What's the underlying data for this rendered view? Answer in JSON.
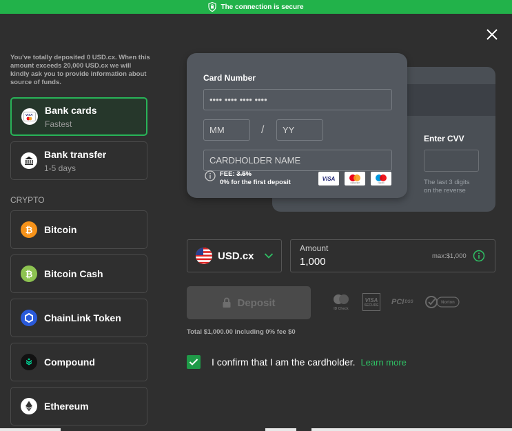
{
  "topbar": {
    "text": "The connection is secure"
  },
  "notice": "You've totally deposited 0 USD.cx. When this amount exceeds 20,000 USD.cx we will kindly ask you to provide information about source of funds.",
  "methods": [
    {
      "title": "Bank cards",
      "sub": "Fastest"
    },
    {
      "title": "Bank transfer",
      "sub": "1-5 days"
    }
  ],
  "crypto_label": "CRYPTO",
  "crypto": [
    {
      "title": "Bitcoin",
      "color": "#f7931a"
    },
    {
      "title": "Bitcoin Cash",
      "color": "#8dc351"
    },
    {
      "title": "ChainLink Token",
      "color": "#2a5ada"
    },
    {
      "title": "Compound",
      "color": "#1a1a1a"
    },
    {
      "title": "Ethereum",
      "color": "#ffffff"
    }
  ],
  "card": {
    "number_label": "Card Number",
    "number_placeholder": "•••• •••• •••• ••••",
    "mm": "MM",
    "slash": "/",
    "yy": "YY",
    "holder": "CARDHOLDER NAME",
    "fee_label": "FEE:",
    "fee_value": "3.5%",
    "fee_note": "0% for the first deposit",
    "cvv_label": "Enter CVV",
    "cvv_hint_1": "The last 3 digits",
    "cvv_hint_2": "on the reverse",
    "brands": [
      "VISA",
      "mastercard",
      "maestro"
    ]
  },
  "currency": {
    "code": "USD.cx"
  },
  "amount": {
    "label": "Amount",
    "value": "1,000",
    "max": "max:$1,000"
  },
  "deposit": {
    "label": "Deposit"
  },
  "trust": [
    "Mastercard ID Check",
    "VISA SECURE",
    "PCI DSS",
    "Norton SECURED"
  ],
  "total": "Total $1,000.00 including 0% fee $0",
  "confirm": {
    "text": "I confirm that I am the cardholder.",
    "link": "Learn more"
  },
  "colors": {
    "accent": "#22b24a",
    "background": "#2f2f2f"
  }
}
